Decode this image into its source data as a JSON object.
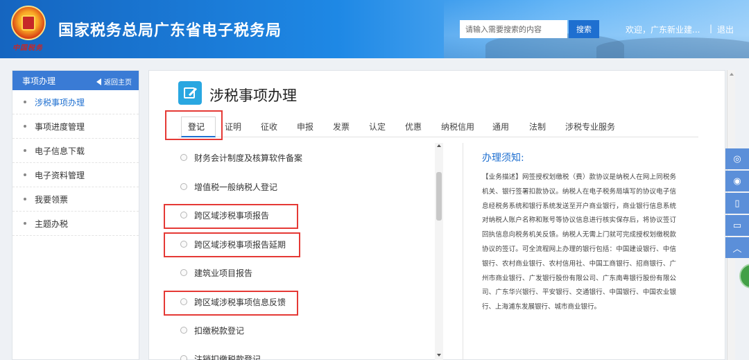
{
  "header": {
    "title": "国家税务总局广东省电子税务局",
    "emblem_script": "中国税务",
    "search_placeholder": "请输入需要搜索的内容",
    "search_button": "搜索",
    "welcome": "欢迎，广东新业建...",
    "separator": "|",
    "logout": "退出"
  },
  "sidebar": {
    "title": "事项办理",
    "back_home": "返回主页",
    "items": [
      {
        "label": "涉税事项办理"
      },
      {
        "label": "事项进度管理"
      },
      {
        "label": "电子信息下载"
      },
      {
        "label": "电子资料管理"
      },
      {
        "label": "我要领票"
      },
      {
        "label": "主题办税"
      }
    ]
  },
  "main": {
    "title": "涉税事项办理",
    "tabs": [
      "登记",
      "证明",
      "征收",
      "申报",
      "发票",
      "认定",
      "优惠",
      "纳税信用",
      "通用",
      "法制",
      "涉税专业服务"
    ],
    "list": [
      "财务会计制度及核算软件备案",
      "增值税一般纳税人登记",
      "跨区域涉税事项报告",
      "跨区域涉税事项报告延期",
      "建筑业项目报告",
      "跨区域涉税事项信息反馈",
      "扣缴税款登记",
      "注销扣缴税款登记"
    ],
    "notice_title": "办理须知:",
    "notice_body": "【业务描述】网签授权划缴税（费）款协议是纳税人在网上同税务机关、银行签署扣款协议。纳税人在电子税务局填写的协议电子信息经税务系统和银行系统发送至开户商业银行，商业银行信息系统对纳税人账户名称和账号等协议信息进行核实保存后，将协议签订回执信息向税务机关反馈。纳税人无需上门就可完成授权划缴税款协议的签订。可全流程网上办理的银行包括：中国建设银行、中信银行、农村商业银行、农村信用社、中国工商银行、招商银行、广州市商业银行、广发银行股份有限公司、广东南粤银行股份有限公司、广东华兴银行、平安银行、交通银行、中国银行、中国农业银行、上海浦东发展银行、城市商业银行。"
  },
  "float_bar": [
    "wechat-icon",
    "weibo-icon",
    "mobile-icon",
    "tablet-icon",
    "back-to-top-icon"
  ],
  "colors": {
    "accent": "#1e6fd0",
    "highlight": "#e53935",
    "header": "#1e88e5"
  }
}
